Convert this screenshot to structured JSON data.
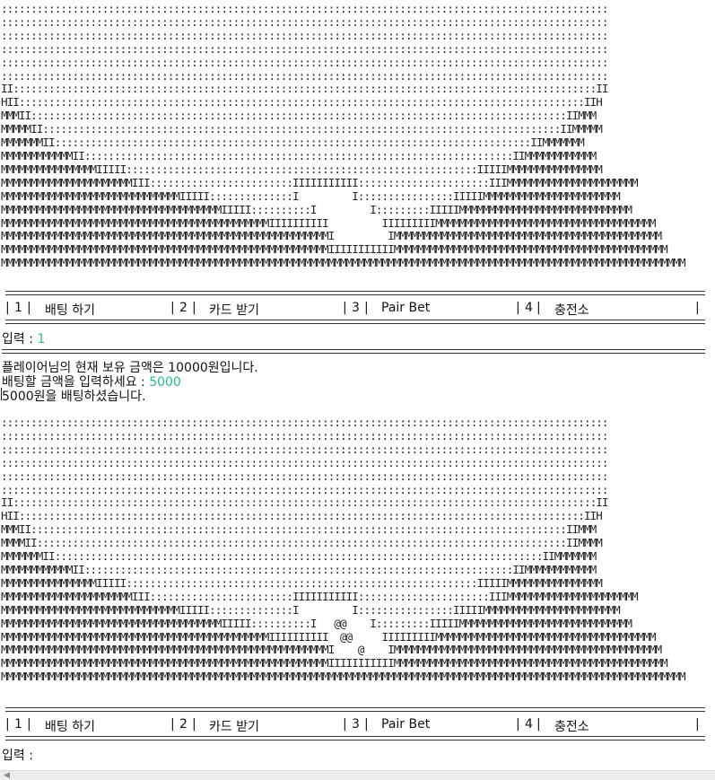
{
  "ascii_art": "::::::::::::::::::::::::::::::::::::::::::::::::::::::::::::::::::::::::::::::::::::::::::::::::::::::\n::::::::::::::::::::::::::::::::::::::::::::::::::::::::::::::::::::::::::::::::::::::::::::::::::::::\n::::::::::::::::::::::::::::::::::::::::::::::::::::::::::::::::::::::::::::::::::::::::::::::::::::::\n::::::::::::::::::::::::::::::::::::::::::::::::::::::::::::::::::::::::::::::::::::::::::::::::::::::\n::::::::::::::::::::::::::::::::::::::::::::::::::::::::::::::::::::::::::::::::::::::::::::::::::::::\n::::::::::::::::::::::::::::::::::::::::::::::::::::::::::::::::::::::::::::::::::::::::::::::::::::::\nII::::::::::::::::::::::::::::::::::::::::::::::::::::::::::::::::::::::::::::::::::::::::::::::::::II\nHII:::::::::::::::::::::::::::::::::::::::::::::::::::::::::::::::::::::::::::::::::::::::::::::::IIH\nMMMII::::::::::::::::::::::::::::::::::::::::::::::::::::::::::::::::::::::::::::::::::::::::::IIMMM\nMMMMMII:::::::::::::::::::::::::::::::::::::::::::::::::::::::::::::::::::::::::::::::::::::::IIMMMMM\nMMMMMMMII::::::::::::::::::::::::::::::::::::::::::::::::::::::::::::::::::::::::::::::::IIMMMMMMM\nMMMMMMMMMMMMII::::::::::::::::::::::::::::::::::::::::::::::::::::::::::::::::::::::::IIMMMMMMMMMMMM\nMMMMMMMMMMMMMMMMIIIII:::::::::::::::::::::::::::::::::::::::::::::::::::::::::::IIIIIMMMMMMMMMMMMMMMM\nMMMMMMMMMMMMMMMMMMMMMMIII::::::::::::::::::::::::IIIIIIIIIII::::::::::::::::::::::IIIMMMMMMMMMMMMMMMMMMMMMM\nMMMMMMMMMMMMMMMMMMMMMMMMMMMMMMIIIII::::::::::::::I         I::::::::::::::::IIIIIMMMMMMMMMMMMMMMMMMMMMMM\nMMMMMMMMMMMMMMMMMMMMMMMMMMMMMMMMMMMMMIIIII::::::::::I         I:::::::::IIIIIMMMMMMMMMMMMMMMMMMMMMMMMMMMMM\nMMMMMMMMMMMMMMMMMMMMMMMMMMMMMMMMMMMMMMMMMMMMMIIIIIIIIII         IIIIIIIIIMMMMMMMMMMMMMMMMMMMMMMMMMMMMMMMMMMMMM\nMMMMMMMMMMMMMMMMMMMMMMMMMMMMMMMMMMMMMMMMMMMMMMMMMMMMMMMI         IMMMMMMMMMMMMMMMMMMMMMMMMMMMMMMMMMMMMMMMMMMMMM\nMMMMMMMMMMMMMMMMMMMMMMMMMMMMMMMMMMMMMMMMMMMMMMMMMMMMMMMIIIIIIIIIIIMMMMMMMMMMMMMMMMMMMMMMMMMMMMMMMMMMMMMMMMMMMMMM\nMMMMMMMMMMMMMMMMMMMMMMMMMMMMMMMMMMMMMMMMMMMMMMMMMMMMMMMMMMMMMMMMMMMMMMMMMMMMMMMMMMMMMMMMMMMMMMMMMMMMMMMMMMMMMMMMMMM",
  "ascii_art_2": "::::::::::::::::::::::::::::::::::::::::::::::::::::::::::::::::::::::::::::::::::::::::::::::::::::::\n::::::::::::::::::::::::::::::::::::::::::::::::::::::::::::::::::::::::::::::::::::::::::::::::::::::\n::::::::::::::::::::::::::::::::::::::::::::::::::::::::::::::::::::::::::::::::::::::::::::::::::::::\n::::::::::::::::::::::::::::::::::::::::::::::::::::::::::::::::::::::::::::::::::::::::::::::::::::::\n::::::::::::::::::::::::::::::::::::::::::::::::::::::::::::::::::::::::::::::::::::::::::::::::::::::\n::::::::::::::::::::::::::::::::::::::::::::::::::::::::::::::::::::::::::::::::::::::::::::::::::::::\nII::::::::::::::::::::::::::::::::::::::::::::::::::::::::::::::::::::::::::::::::::::::::::::::::::II\nHII:::::::::::::::::::::::::::::::::::::::::::::::::::::::::::::::::::::::::::::::::::::::::::::::IIH\nMMMII::::::::::::::::::::::::::::::::::::::::::::::::::::::::::::::::::::::::::::::::::::::::::IIMMM\nMMMMII:::::::::::::::::::::::::::::::::::::::::::::::::::::::::::::::::::::::::::::::::::::::::IIMMMM\nMMMMMMMII::::::::::::::::::::::::::::::::::::::::::::::::::::::::::::::::::::::::::::::::::IIMMMMMMM\nMMMMMMMMMMMMII::::::::::::::::::::::::::::::::::::::::::::::::::::::::::::::::::::::::IIMMMMMMMMMMMM\nMMMMMMMMMMMMMMMMIIIII:::::::::::::::::::::::::::::::::::::::::::::::::::::::::::IIIIIMMMMMMMMMMMMMMMM\nMMMMMMMMMMMMMMMMMMMMMMIII::::::::::::::::::::::::IIIIIIIIIII::::::::::::::::::::::IIIMMMMMMMMMMMMMMMMMMMMMM\nMMMMMMMMMMMMMMMMMMMMMMMMMMMMMMIIIII::::::::::::::I         I::::::::::::::::IIIIIMMMMMMMMMMMMMMMMMMMMMMM\nMMMMMMMMMMMMMMMMMMMMMMMMMMMMMMMMMMMMMIIIII::::::::::I   @@    I:::::::::IIIIIMMMMMMMMMMMMMMMMMMMMMMMMMMMMM\nMMMMMMMMMMMMMMMMMMMMMMMMMMMMMMMMMMMMMMMMMMMMMIIIIIIIIII  @@     IIIIIIIIIMMMMMMMMMMMMMMMMMMMMMMMMMMMMMMMMMMMMM\nMMMMMMMMMMMMMMMMMMMMMMMMMMMMMMMMMMMMMMMMMMMMMMMMMMMMMMMI    @    IMMMMMMMMMMMMMMMMMMMMMMMMMMMMMMMMMMMMMMMMMMMMM\nMMMMMMMMMMMMMMMMMMMMMMMMMMMMMMMMMMMMMMMMMMMMMMMMMMMMMMMIIIIIIIIIIIMMMMMMMMMMMMMMMMMMMMMMMMMMMMMMMMMMMMMMMMMMMMMM\nMMMMMMMMMMMMMMMMMMMMMMMMMMMMMMMMMMMMMMMMMMMMMMMMMMMMMMMMMMMMMMMMMMMMMMMMMMMMMMMMMMMMMMMMMMMMMMMMMMMMMMMMMMMMMMMMMMM",
  "menu": {
    "left_border": "|",
    "items": [
      {
        "num": "1",
        "label": "배팅 하기"
      },
      {
        "num": "2",
        "label": "카드 받기"
      },
      {
        "num": "3",
        "label": "Pair Bet"
      },
      {
        "num": "4",
        "label": "충전소"
      }
    ],
    "right_border": "|"
  },
  "console": {
    "prompt_label": "입력 : ",
    "first_input": "1",
    "balance_msg": "플레이어님의 현재 보유 금액은 10000원입니다.",
    "bet_prompt": "배팅할 금액을 입력하세요 : ",
    "bet_value": "5000",
    "bet_confirm": "5000원을 배팅하셨습니다.",
    "final_prompt": "입력 : "
  },
  "colors": {
    "input_value": "#2bb58a",
    "text": "#111111",
    "background": "#ffffff"
  }
}
